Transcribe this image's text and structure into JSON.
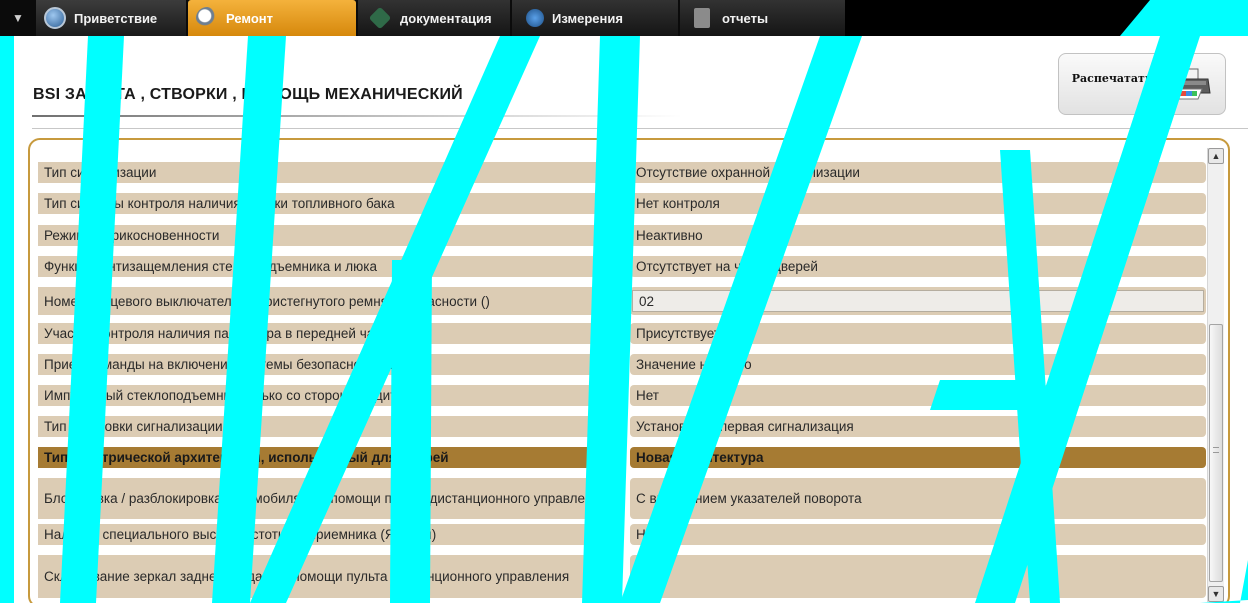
{
  "tabs": [
    {
      "label": "Приветствие",
      "active": false
    },
    {
      "label": "Ремонт",
      "active": true
    },
    {
      "label": "документация",
      "active": false
    },
    {
      "label": "Измерения",
      "active": false
    },
    {
      "label": "отчеты",
      "active": false
    }
  ],
  "header": {
    "title": "BSI  ЗАЩИТА , СТВОРКИ , ПОМОЩЬ МЕХАНИЧЕСКИЙ",
    "print_label": "Распечатать"
  },
  "rows": [
    {
      "label": "Тип сигнализации",
      "value": "Отсутствие охранной сигнализации"
    },
    {
      "label": "Тип системы контроля наличия пробки топливного бака",
      "value": "Нет контроля"
    },
    {
      "label": "Режим неприкосновенности",
      "value": "Неактивно"
    },
    {
      "label": "Функция антизащемления стеклоподъемника и люка",
      "value": "Отсутствует на части дверей"
    },
    {
      "label": "Номер концевого выключателя непристегнутого ремня безопасности ()",
      "value": "02"
    },
    {
      "label": "Участок контроля наличия пассажира в передней части",
      "value": "Присутствует"
    },
    {
      "label": "Прием команды на включение системы безопасности детей",
      "value": "Значение неверно"
    },
    {
      "label": "Импульсный стеклоподъемник только со стороны водителя",
      "value": "Нет"
    },
    {
      "label": "Тип установки сигнализации",
      "value": "Установлена первая сигнализация"
    },
    {
      "label": "Тип электрической архитектуры, используемый для дверей",
      "value": "Новая архитектура"
    },
    {
      "label": "Блокировка / разблокировка автомобиля при помощи пульта дистанционного управления",
      "value": "С включением указателей поворота"
    },
    {
      "label": "Наличие специального высокочастотного приемника (Япония)",
      "value": "Нет"
    },
    {
      "label": "Складывание зеркал заднего вида при помощи пульта дистанционного управления",
      "value": "Нет"
    }
  ],
  "colors": {
    "active_tab": "#e59b1c",
    "row_bg": "#dcccb4",
    "row_highlight": "#a67b33",
    "panel_border": "#c79a3d",
    "watermark": "#00ffff"
  }
}
